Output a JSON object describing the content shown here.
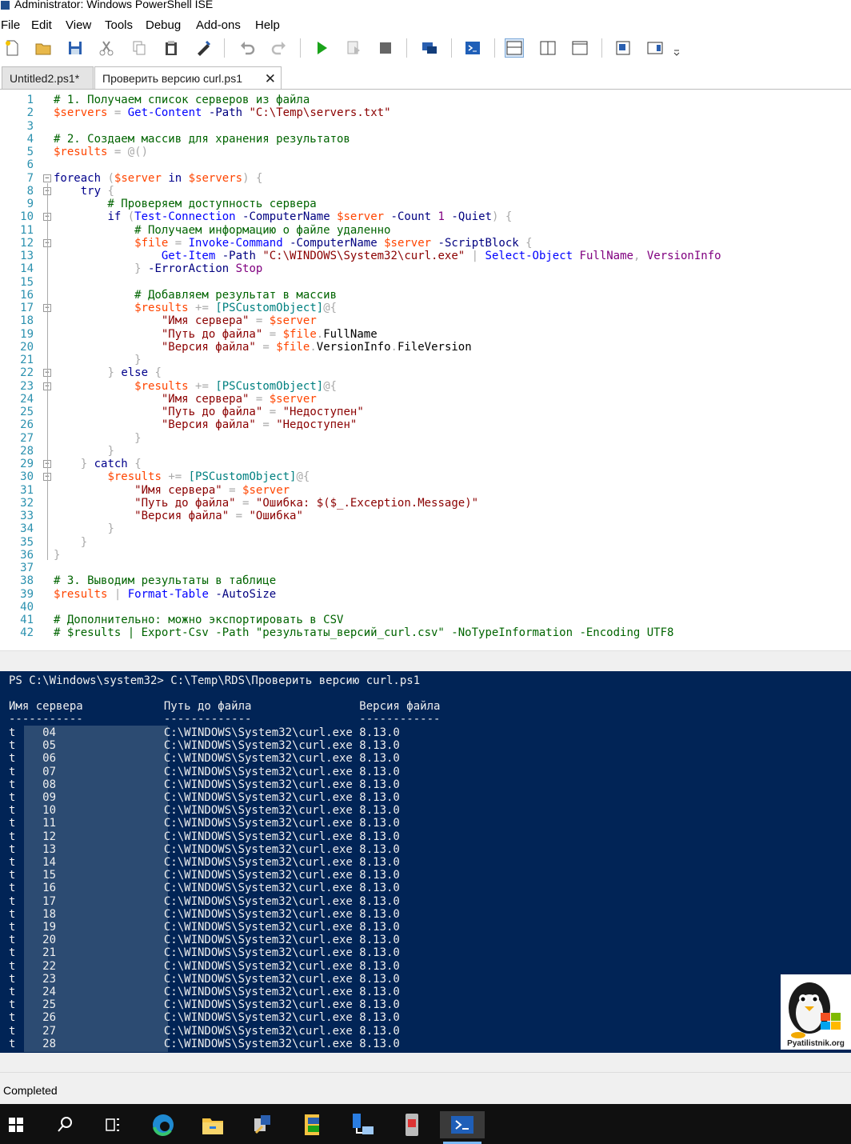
{
  "window": {
    "title": "Administrator: Windows PowerShell ISE"
  },
  "menu": [
    "File",
    "Edit",
    "View",
    "Tools",
    "Debug",
    "Add-ons",
    "Help"
  ],
  "toolbar": [
    "new-icon",
    "open-icon",
    "save-icon",
    "cut-icon",
    "copy-icon",
    "paste-icon",
    "clear-icon",
    "undo-icon",
    "redo-icon",
    "run-icon",
    "run-selection-icon",
    "stop-icon",
    "remote-powershell-icon",
    "start-powershell-icon",
    "script-pane-top-icon",
    "script-pane-right-icon",
    "script-pane-max-icon",
    "commands-icon",
    "show-addon-icon"
  ],
  "tabs": [
    {
      "label": "Untitled2.ps1*",
      "active": false
    },
    {
      "label": "Проверить версию curl.ps1",
      "active": true,
      "close": "✕"
    }
  ],
  "script": {
    "lines": [
      "# 1. Получаем список серверов из файла",
      "$servers = Get-Content -Path \"C:\\Temp\\servers.txt\"",
      "",
      "# 2. Создаем массив для хранения результатов",
      "$results = @()",
      "",
      "foreach ($server in $servers) {",
      "    try {",
      "        # Проверяем доступность сервера",
      "        if (Test-Connection -ComputerName $server -Count 1 -Quiet) {",
      "            # Получаем информацию о файле удаленно",
      "            $file = Invoke-Command -ComputerName $server -ScriptBlock {",
      "                Get-Item -Path \"C:\\WINDOWS\\System32\\curl.exe\" | Select-Object FullName, VersionInfo",
      "            } -ErrorAction Stop",
      "",
      "            # Добавляем результат в массив",
      "            $results += [PSCustomObject]@{",
      "                \"Имя сервера\" = $server",
      "                \"Путь до файла\" = $file.FullName",
      "                \"Версия файла\" = $file.VersionInfo.FileVersion",
      "            }",
      "        } else {",
      "            $results += [PSCustomObject]@{",
      "                \"Имя сервера\" = $server",
      "                \"Путь до файла\" = \"Недоступен\"",
      "                \"Версия файла\" = \"Недоступен\"",
      "            }",
      "        }",
      "    } catch {",
      "        $results += [PSCustomObject]@{",
      "            \"Имя сервера\" = $server",
      "            \"Путь до файла\" = \"Ошибка: $($_.Exception.Message)\"",
      "            \"Версия файла\" = \"Ошибка\"",
      "        }",
      "    }",
      "}",
      "",
      "# 3. Выводим результаты в таблице",
      "$results | Format-Table -AutoSize",
      "",
      "# Дополнительно: можно экспортировать в CSV",
      "# $results | Export-Csv -Path \"результаты_версий_curl.csv\" -NoTypeInformation -Encoding UTF8"
    ]
  },
  "console": {
    "prompt": "PS C:\\Windows\\system32> C:\\Temp\\RDS\\Проверить версию curl.ps1",
    "headers": [
      "Имя сервера",
      "Путь до файла",
      "Версия файла"
    ],
    "underlines": [
      "-----------",
      "-------------",
      "------------"
    ],
    "server_prefix": "t",
    "server_suffixes": [
      "04",
      "05",
      "06",
      "07",
      "08",
      "09",
      "10",
      "11",
      "12",
      "13",
      "14",
      "15",
      "16",
      "17",
      "18",
      "19",
      "20",
      "21",
      "22",
      "23",
      "24",
      "25",
      "26",
      "27",
      "28"
    ],
    "path": "C:\\WINDOWS\\System32\\curl.exe",
    "version": "8.13.0"
  },
  "status": "Completed",
  "watermark": "Pyatilistnik.org",
  "taskbar": [
    "windows-start-icon",
    "search-icon",
    "task-view-icon",
    "edge-icon",
    "file-explorer-icon",
    "server-manager-icon",
    "powershell-folder-icon",
    "network-icon",
    "remote-desktop-icon",
    "powershell-ise-icon"
  ]
}
